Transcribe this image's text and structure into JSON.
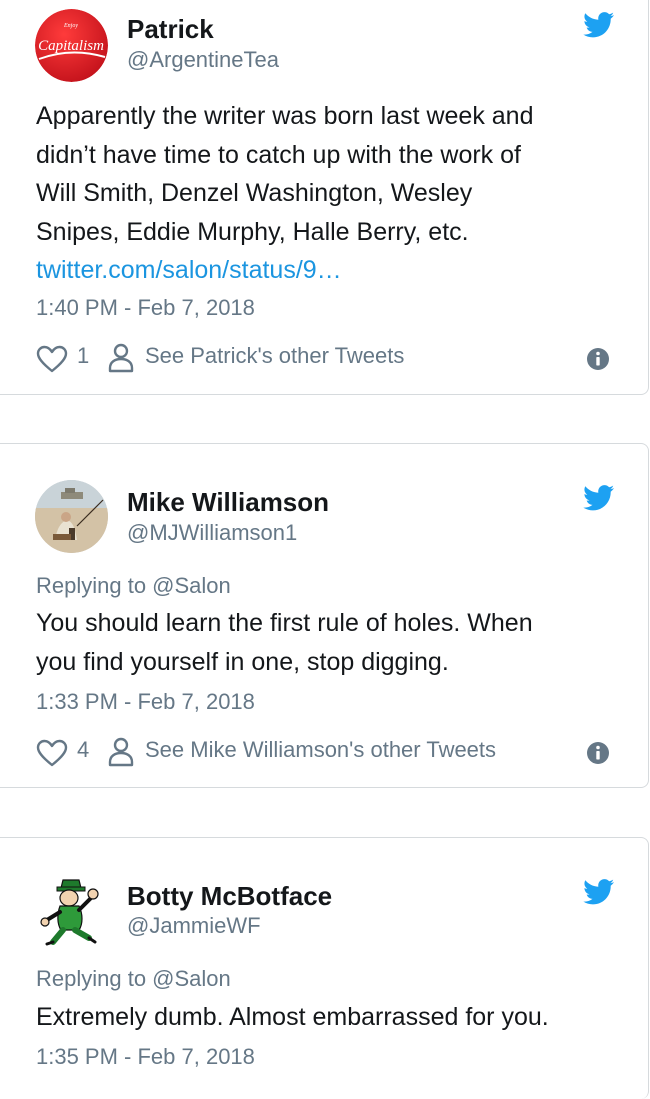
{
  "tweets": [
    {
      "name": "Patrick",
      "handle": "@ArgentineTea",
      "text_lines": [
        "Apparently the writer was born last week and",
        "didn’t have time to catch up with the work of",
        "Will Smith, Denzel Washington, Wesley",
        "Snipes,  Eddie Murphy, Halle Berry, etc."
      ],
      "link": "twitter.com/salon/status/9…",
      "time": "1:40 PM - Feb 7, 2018",
      "likes": "1",
      "see_other": "See Patrick's other Tweets",
      "avatar_text": "Capitalism"
    },
    {
      "name": "Mike Williamson",
      "handle": "@MJWilliamson1",
      "replying": "Replying to @Salon",
      "text_lines": [
        "You should learn the first rule of holes. When",
        "you find yourself in one, stop digging."
      ],
      "time": "1:33 PM - Feb 7, 2018",
      "likes": "4",
      "see_other": "See Mike Williamson's other Tweets"
    },
    {
      "name": "Botty McBotface",
      "handle": "@JammieWF",
      "replying": "Replying to @Salon",
      "text_lines": [
        "Extremely dumb. Almost embarrassed for you."
      ],
      "time": "1:35 PM - Feb 7, 2018"
    }
  ],
  "colors": {
    "link": "#1b95e0",
    "twitter_blue": "#1da1f2",
    "secondary_text": "#657786",
    "avatar_red": "#e21f26"
  },
  "icons": [
    "twitter-bird-icon",
    "heart-icon",
    "person-icon",
    "info-icon"
  ]
}
